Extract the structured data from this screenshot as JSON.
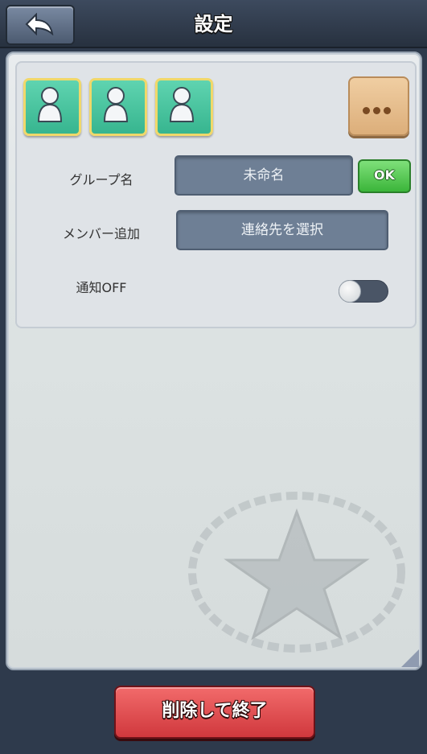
{
  "header": {
    "title": "設定",
    "back_icon": "back-arrow-icon"
  },
  "members": [
    {
      "icon": "user-icon"
    },
    {
      "icon": "user-icon"
    },
    {
      "icon": "user-icon"
    }
  ],
  "more_icon": "ellipsis-icon",
  "form": {
    "group_name_label": "グループ名",
    "group_name_value": "未命名",
    "ok_label": "OK",
    "add_member_label": "メンバー追加",
    "select_contacts_label": "連絡先を選択",
    "notify_label": "通知OFF",
    "notify_on": false
  },
  "footer": {
    "delete_label": "削除して終了"
  },
  "colors": {
    "accent_green": "#3bb53a",
    "danger_red": "#d0383d",
    "member_teal": "#37b58f"
  }
}
